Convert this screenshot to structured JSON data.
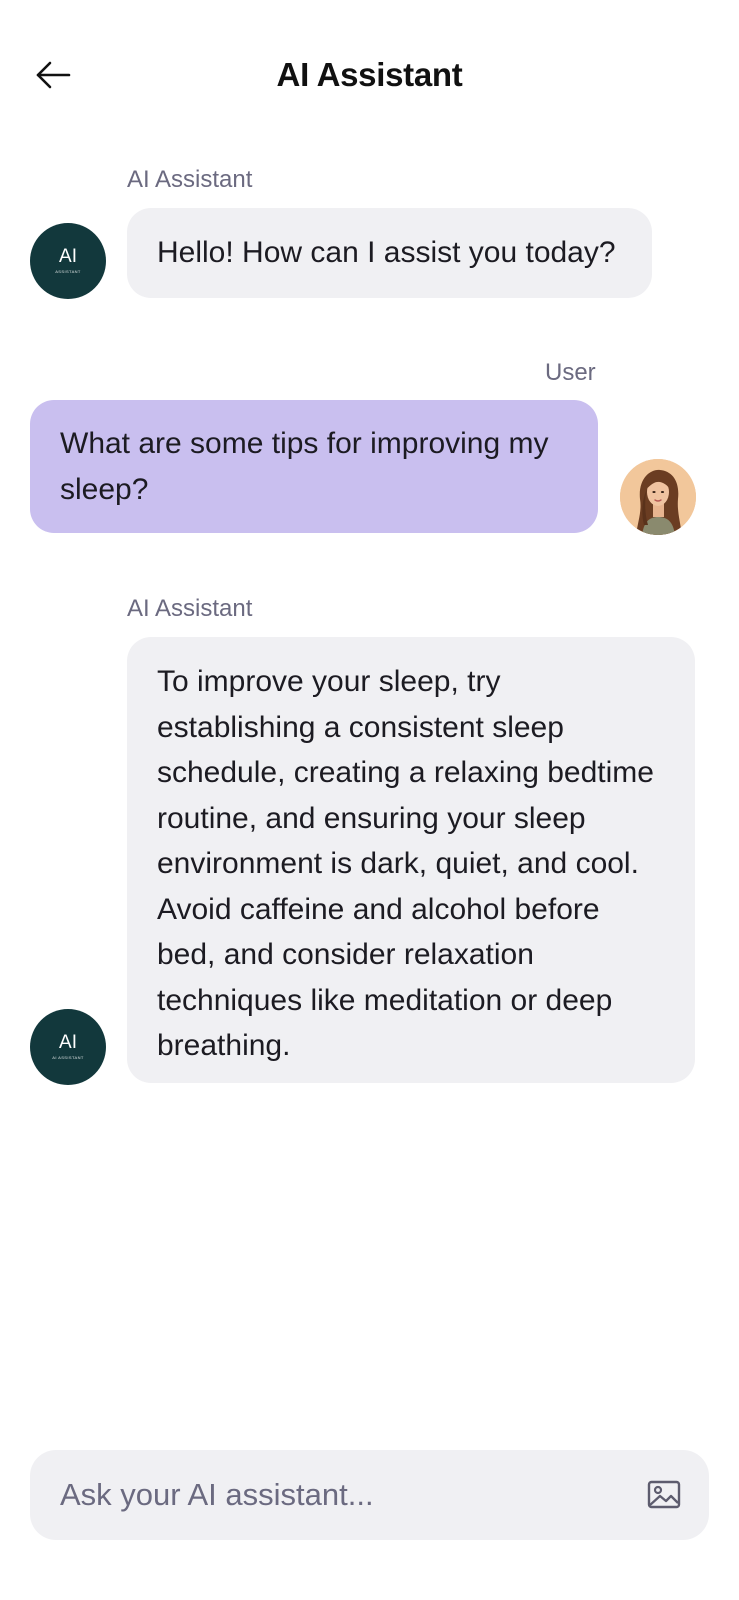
{
  "header": {
    "title": "AI Assistant",
    "back_icon": "arrow-left-icon"
  },
  "messages": [
    {
      "role": "assistant",
      "sender": "AI Assistant",
      "text": "Hello! How can I assist you today?",
      "avatar": {
        "initials": "AI",
        "caption": "ASSISTANT"
      }
    },
    {
      "role": "user",
      "sender": "User",
      "text": "What are some tips for improving my sleep?",
      "avatar": "user-portrait"
    },
    {
      "role": "assistant",
      "sender": "AI Assistant",
      "text": "To improve your sleep, try establishing a consistent sleep schedule, creating a relaxing bedtime routine, and ensuring your sleep environment is dark, quiet, and cool. Avoid caffeine and alcohol before bed, and consider relaxation techniques like meditation or deep breathing.",
      "avatar": {
        "initials": "AI",
        "caption": "AI ASSISTANT"
      }
    }
  ],
  "composer": {
    "placeholder": "Ask your AI assistant...",
    "value": "",
    "attach_icon": "image-icon"
  },
  "colors": {
    "user_bubble": "#c9bfef",
    "ai_bubble": "#f0f0f3",
    "ai_avatar": "#12383c",
    "label": "#6b6a80"
  }
}
